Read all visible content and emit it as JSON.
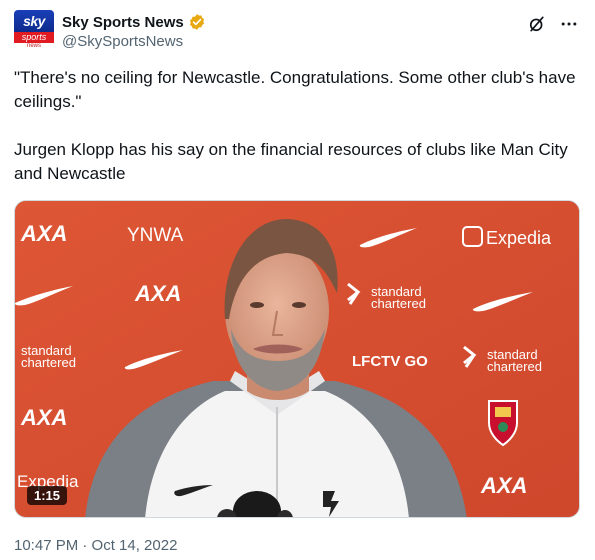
{
  "author": {
    "display_name": "Sky Sports News",
    "handle": "@SkySportsNews",
    "verified": true,
    "verified_color": "#f4b400",
    "avatar": {
      "line1": "sky",
      "line2": "sports",
      "line3": "news"
    }
  },
  "actions": {
    "grok_icon": "grok-icon",
    "more_icon": "more-icon"
  },
  "tweet": {
    "paragraph1": "\"There's no ceiling for Newcastle. Congratulations. Some other club's have ceilings.\"",
    "paragraph2": "Jurgen Klopp has his say on the financial resources of clubs like Man City and Newcastle"
  },
  "media": {
    "type": "video",
    "duration": "1:15",
    "backdrop_color": "#d94f32",
    "sponsor_labels": {
      "axa": "AXA",
      "ynwa": "YNWA",
      "expedia": "Expedia",
      "standard_chartered_1": "standard",
      "standard_chartered_2": "chartered",
      "lfctv": "LFCTV GO"
    }
  },
  "timestamp": "10:47 PM · Oct 14, 2022"
}
